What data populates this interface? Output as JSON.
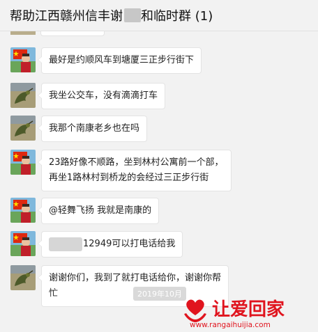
{
  "header": {
    "title": "帮助江西赣州信丰谢",
    "title_suffix": "和临时群 (1)"
  },
  "messages": [
    {
      "avatar": "flag-avatar",
      "text": "最好是约顺风车到塘厦三正步行街下"
    },
    {
      "avatar": "dragon-avatar",
      "text": "我坐公交车，没有滴滴打车"
    },
    {
      "avatar": "dragon-avatar",
      "text": "我那个南康老乡也在吗"
    },
    {
      "avatar": "flag-avatar",
      "line1": "23路好像不顺路，坐到林村公寓前一个部，",
      "line2": "再坐1路林村到桥龙的会经过三正步行街"
    },
    {
      "avatar": "flag-avatar",
      "text": "@轻舞飞扬 我就是南康的"
    },
    {
      "avatar": "flag-avatar",
      "text": "12949可以打电话给我"
    },
    {
      "avatar": "dragon-avatar",
      "line1": "谢谢你们，我到了就打电话给你，谢谢你帮",
      "line2": "忙"
    }
  ],
  "timestamp": "2019年10月",
  "watermark": {
    "text": "让爱回家",
    "url": "www.rangaihuijia.com",
    "color": "#e0141e"
  }
}
